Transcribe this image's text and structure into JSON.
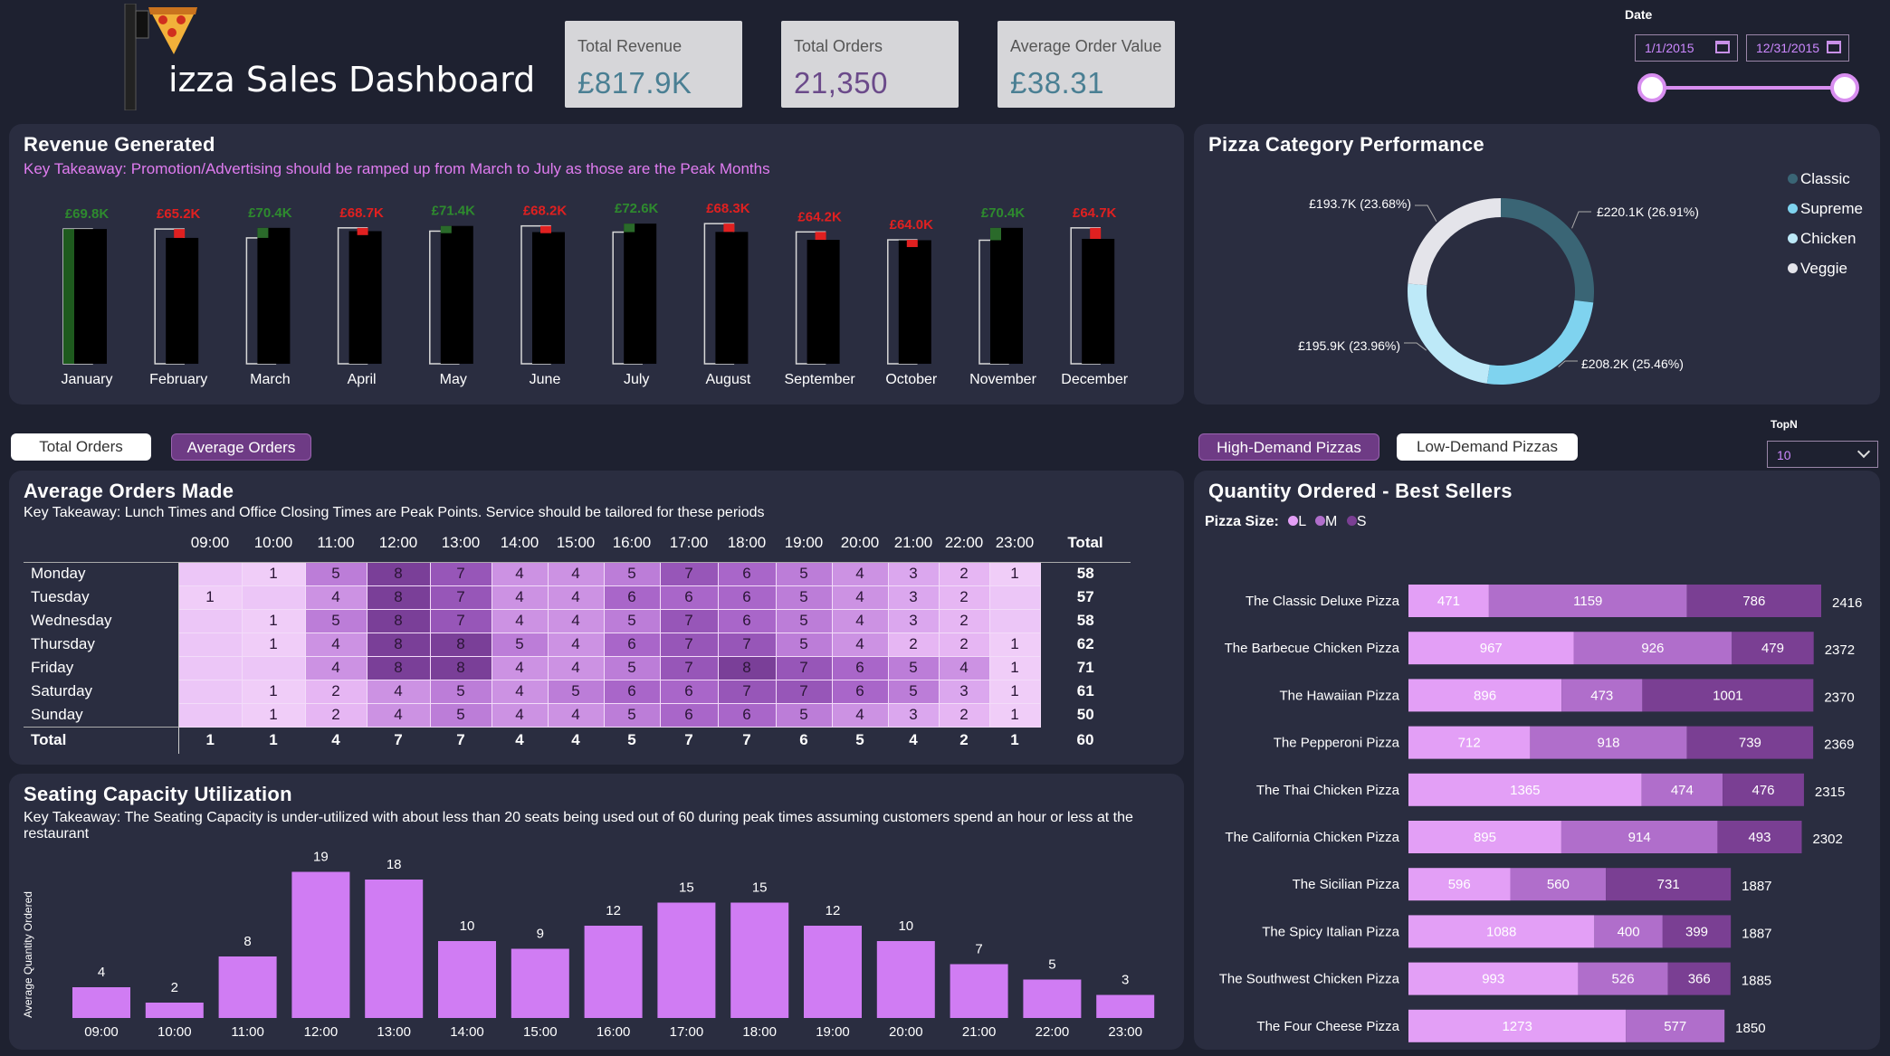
{
  "header": {
    "title_rest": "izza Sales Dashboard",
    "kpis": [
      {
        "label": "Total Revenue",
        "value": "£817.9K"
      },
      {
        "label": "Total Orders",
        "value": "21,350"
      },
      {
        "label": "Average Order Value",
        "value": "£38.31"
      }
    ],
    "date_label": "Date",
    "date_start": "1/1/2015",
    "date_end": "12/31/2015",
    "slider_range": [
      0,
      1
    ]
  },
  "revenue": {
    "title": "Revenue Generated",
    "takeaway": "Key Takeaway: Promotion/Advertising should be ramped up from March to July as those are the Peak Months"
  },
  "category": {
    "title": "Pizza Category Performance",
    "legend": [
      {
        "name": "Classic",
        "color": "#3a6575"
      },
      {
        "name": "Supreme",
        "color": "#7fd3ef"
      },
      {
        "name": "Chicken",
        "color": "#bde9f8"
      },
      {
        "name": "Veggie",
        "color": "#e4e4ea"
      }
    ],
    "labels": [
      "£220.1K (26.91%)",
      "£208.2K (25.46%)",
      "£195.9K (23.96%)",
      "£193.7K (23.68%)"
    ]
  },
  "toggles": {
    "total_orders": "Total Orders",
    "average_orders": "Average Orders",
    "high_demand": "High-Demand Pizzas",
    "low_demand": "Low-Demand Pizzas"
  },
  "topn": {
    "label": "TopN",
    "value": "10"
  },
  "avg_orders": {
    "title": "Average Orders Made",
    "takeaway": "Key Takeaway: Lunch Times and Office Closing Times are Peak Points. Service should be tailored for these periods",
    "hours": [
      "09:00",
      "10:00",
      "11:00",
      "12:00",
      "13:00",
      "14:00",
      "15:00",
      "16:00",
      "17:00",
      "18:00",
      "19:00",
      "20:00",
      "21:00",
      "22:00",
      "23:00"
    ],
    "total_header": "Total",
    "total_label": "Total",
    "rows": [
      {
        "day": "Monday",
        "values": [
          "",
          "1",
          "5",
          "8",
          "7",
          "4",
          "4",
          "5",
          "7",
          "6",
          "5",
          "4",
          "3",
          "2",
          "1"
        ],
        "total": "58"
      },
      {
        "day": "Tuesday",
        "values": [
          "1",
          "",
          "4",
          "8",
          "7",
          "4",
          "4",
          "6",
          "6",
          "6",
          "5",
          "4",
          "3",
          "2",
          ""
        ],
        "total": "57"
      },
      {
        "day": "Wednesday",
        "values": [
          "",
          "1",
          "5",
          "8",
          "7",
          "4",
          "4",
          "5",
          "7",
          "6",
          "5",
          "4",
          "3",
          "2",
          ""
        ],
        "total": "58"
      },
      {
        "day": "Thursday",
        "values": [
          "",
          "1",
          "4",
          "8",
          "8",
          "5",
          "4",
          "6",
          "7",
          "7",
          "5",
          "4",
          "2",
          "2",
          "1"
        ],
        "total": "62"
      },
      {
        "day": "Friday",
        "values": [
          "",
          "",
          "4",
          "8",
          "8",
          "4",
          "4",
          "5",
          "7",
          "8",
          "7",
          "6",
          "5",
          "4",
          "1"
        ],
        "total": "71"
      },
      {
        "day": "Saturday",
        "values": [
          "",
          "1",
          "2",
          "4",
          "5",
          "4",
          "5",
          "6",
          "6",
          "7",
          "7",
          "6",
          "5",
          "3",
          "1"
        ],
        "total": "61"
      },
      {
        "day": "Sunday",
        "values": [
          "",
          "1",
          "2",
          "4",
          "5",
          "4",
          "4",
          "5",
          "6",
          "6",
          "5",
          "4",
          "3",
          "2",
          "1"
        ],
        "total": "50"
      }
    ],
    "totals": [
      "1",
      "1",
      "4",
      "7",
      "7",
      "4",
      "4",
      "5",
      "7",
      "7",
      "6",
      "5",
      "4",
      "2",
      "1"
    ],
    "grand_total": "60"
  },
  "seating": {
    "title": "Seating Capacity Utilization",
    "takeaway": "Key Takeaway:  The Seating Capacity is under-utilized with about less than 20 seats being used out of 60 during peak times assuming customers spend an hour or less at the restaurant"
  },
  "best_sellers": {
    "title": "Quantity Ordered - Best Sellers",
    "size_label": "Pizza Size:",
    "sizes": [
      {
        "name": "L",
        "color": "#e39ff6"
      },
      {
        "name": "M",
        "color": "#b06ecb"
      },
      {
        "name": "S",
        "color": "#7a3f93"
      }
    ]
  },
  "chart_data": [
    {
      "type": "bar",
      "title": "Revenue Generated",
      "categories": [
        "January",
        "February",
        "March",
        "April",
        "May",
        "June",
        "July",
        "August",
        "September",
        "October",
        "November",
        "December"
      ],
      "values": [
        69.8,
        65.2,
        70.4,
        68.7,
        71.4,
        68.2,
        72.6,
        68.3,
        64.2,
        64.0,
        70.4,
        64.7
      ],
      "labels": [
        "£69.8K",
        "£65.2K",
        "£70.4K",
        "£68.7K",
        "£71.4K",
        "£68.2K",
        "£72.6K",
        "£68.3K",
        "£64.2K",
        "£64.0K",
        "£70.4K",
        "£64.7K"
      ],
      "label_colors": [
        "#2e8b2e",
        "#e02020",
        "#2e8b2e",
        "#e02020",
        "#2e8b2e",
        "#e02020",
        "#2e8b2e",
        "#e02020",
        "#e02020",
        "#e02020",
        "#2e8b2e",
        "#e02020"
      ],
      "ylim": [
        0,
        75
      ]
    },
    {
      "type": "pie",
      "title": "Pizza Category Performance",
      "categories": [
        "Classic",
        "Supreme",
        "Chicken",
        "Veggie"
      ],
      "values": [
        220.1,
        208.2,
        195.9,
        193.7
      ],
      "percent": [
        26.91,
        25.46,
        23.96,
        23.68
      ]
    },
    {
      "type": "heatmap",
      "title": "Average Orders Made"
    },
    {
      "type": "bar",
      "title": "Seating Capacity Utilization",
      "ylabel": "Average Quantity Ordered",
      "categories": [
        "09:00",
        "10:00",
        "11:00",
        "12:00",
        "13:00",
        "14:00",
        "15:00",
        "16:00",
        "17:00",
        "18:00",
        "19:00",
        "20:00",
        "21:00",
        "22:00",
        "23:00"
      ],
      "values": [
        4,
        2,
        8,
        19,
        18,
        10,
        9,
        12,
        15,
        15,
        12,
        10,
        7,
        5,
        3
      ],
      "ylim": [
        0,
        20
      ]
    },
    {
      "type": "bar",
      "title": "Quantity Ordered - Best Sellers",
      "categories": [
        "The Classic Deluxe Pizza",
        "The Barbecue Chicken Pizza",
        "The Hawaiian Pizza",
        "The Pepperoni Pizza",
        "The Thai Chicken Pizza",
        "The California Chicken Pizza",
        "The Sicilian Pizza",
        "The Spicy Italian Pizza",
        "The Southwest Chicken Pizza",
        "The Four Cheese Pizza"
      ],
      "series": [
        {
          "name": "L",
          "values": [
            471,
            967,
            896,
            712,
            1365,
            895,
            596,
            1088,
            993,
            1273
          ]
        },
        {
          "name": "M",
          "values": [
            1159,
            926,
            473,
            918,
            474,
            914,
            560,
            400,
            526,
            577
          ]
        },
        {
          "name": "S",
          "values": [
            786,
            479,
            1001,
            739,
            476,
            493,
            731,
            399,
            366,
            0
          ]
        }
      ],
      "totals": [
        2416,
        2372,
        2370,
        2369,
        2315,
        2302,
        1887,
        1887,
        1885,
        1850
      ]
    }
  ]
}
